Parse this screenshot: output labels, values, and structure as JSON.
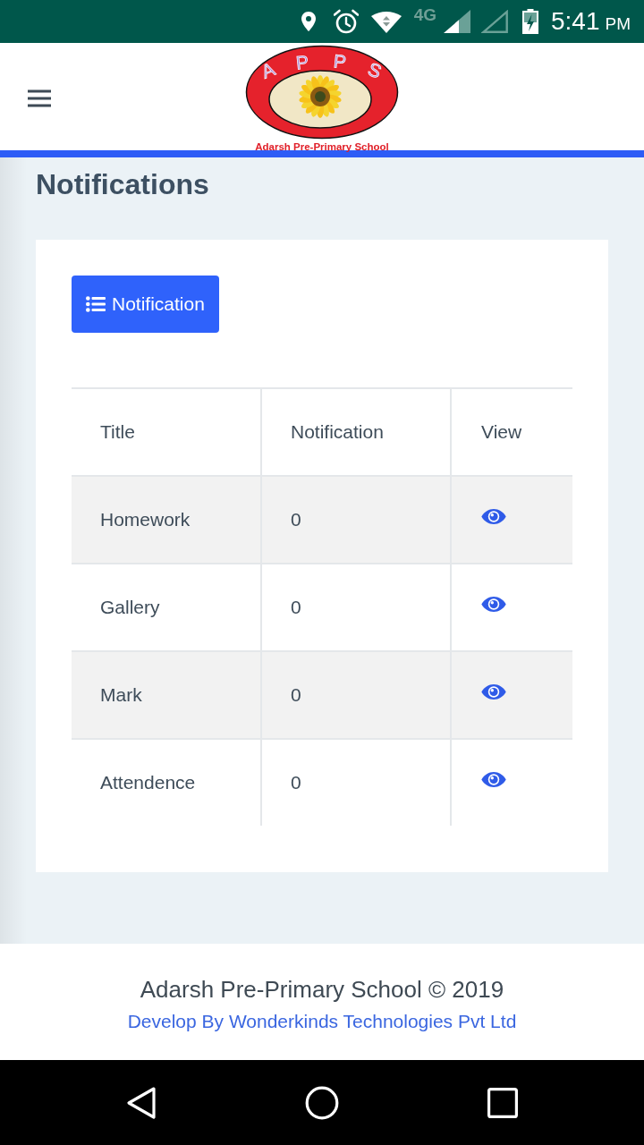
{
  "status_bar": {
    "network": "4G",
    "time": "5:41",
    "meridiem": "PM"
  },
  "header": {
    "logo_letters": [
      "A",
      "P",
      "P",
      "S"
    ],
    "logo_caption": "Adarsh Pre-Primary School"
  },
  "page_title": "Notifications",
  "card": {
    "button": "Notification",
    "table": {
      "columns": [
        "Title",
        "Notification",
        "View"
      ],
      "rows": [
        {
          "title": "Homework",
          "notification": "0"
        },
        {
          "title": "Gallery",
          "notification": "0"
        },
        {
          "title": "Mark",
          "notification": "0"
        },
        {
          "title": "Attendence",
          "notification": "0"
        }
      ]
    }
  },
  "footer": {
    "copyright": "Adarsh Pre-Primary School © 2019",
    "credit": "Develop By Wonderkinds Technologies Pvt Ltd"
  }
}
